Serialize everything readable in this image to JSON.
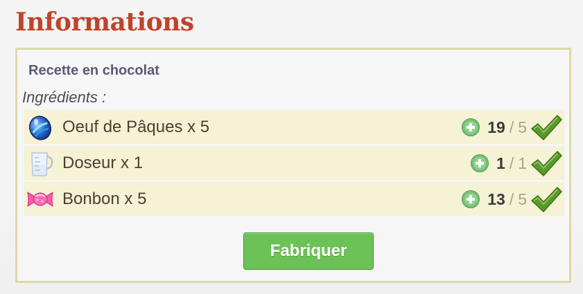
{
  "page": {
    "title": "Informations"
  },
  "recipe": {
    "name": "Recette en chocolat",
    "ingredients_label": "Ingrédients :",
    "items": [
      {
        "name": "Oeuf de Pâques x 5",
        "have": "19",
        "separator": "/",
        "need": "5",
        "icon": "easter-egg-icon"
      },
      {
        "name": "Doseur x 1",
        "have": "1",
        "separator": "/",
        "need": "1",
        "icon": "measuring-cup-icon"
      },
      {
        "name": "Bonbon x 5",
        "have": "13",
        "separator": "/",
        "need": "5",
        "icon": "candy-icon"
      }
    ],
    "craft_button": "Fabriquer"
  },
  "colors": {
    "title": "#c0432b",
    "panel_border": "#dcd9a8",
    "row_bg": "#f5f2d5",
    "button_green": "#6cc257",
    "check_green": "#5a9a2a"
  }
}
